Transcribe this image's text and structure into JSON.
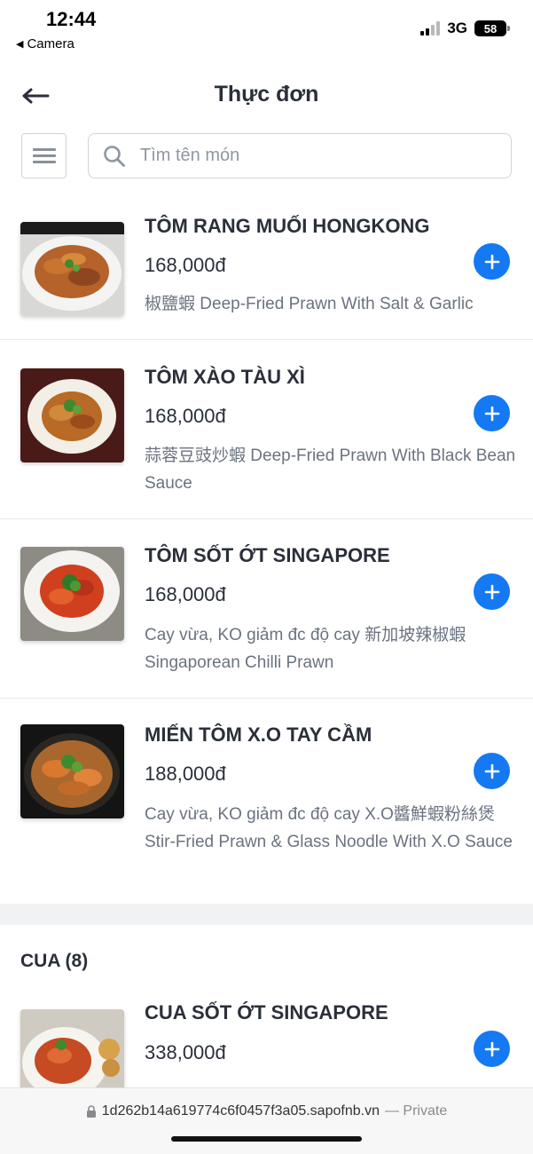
{
  "status_bar": {
    "time": "12:44",
    "back_app": "Camera",
    "network": "3G",
    "battery": "58"
  },
  "header": {
    "title": "Thực đơn"
  },
  "search": {
    "placeholder": "Tìm tên món",
    "value": ""
  },
  "items": [
    {
      "name": "TÔM RANG MUỐI HONGKONG",
      "price": "168,000đ",
      "description": "椒鹽蝦 Deep-Fried Prawn With Salt & Garlic"
    },
    {
      "name": "TÔM XÀO TÀU XÌ",
      "price": "168,000đ",
      "description": "蒜蓉豆豉炒蝦 Deep-Fried Prawn With Black Bean Sauce"
    },
    {
      "name": "TÔM SỐT ỚT SINGAPORE",
      "price": "168,000đ",
      "description": "Cay vừa, KO giảm đc độ cay 新加坡辣椒蝦 Singaporean Chilli Prawn"
    },
    {
      "name": "MIẾN TÔM X.O TAY CẦM",
      "price": "188,000đ",
      "description": "Cay vừa, KO giảm đc độ cay X.O醬鮮蝦粉絲煲 Stir-Fried Prawn & Glass Noodle With X.O Sauce"
    }
  ],
  "section": {
    "title": "CUA (8)"
  },
  "section_items": [
    {
      "name": "CUA SỐT ỚT SINGAPORE",
      "price": "338,000đ"
    }
  ],
  "url_bar": {
    "url": "1d262b14a619774c6f0457f3a05.sapofnb.vn",
    "suffix": "— Private"
  },
  "colors": {
    "accent": "#1479f2",
    "text": "#2a2f3a",
    "muted": "#6b7280"
  }
}
